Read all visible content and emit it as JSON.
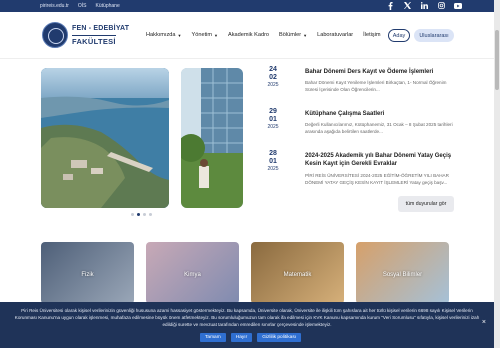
{
  "topbar": {
    "links": [
      "pirireis.edu.tr",
      "OİS",
      "Kütüphane"
    ],
    "social": [
      "facebook-icon",
      "x-icon",
      "linkedin-icon",
      "instagram-icon",
      "youtube-icon"
    ]
  },
  "header": {
    "logo_line1": "FEN - EDEBİYAT",
    "logo_line2": "FAKÜLTESİ",
    "nav": [
      {
        "label": "Hakkımızda",
        "caret": true
      },
      {
        "label": "Yönetim",
        "caret": true
      },
      {
        "label": "Akademik Kadro",
        "caret": false
      },
      {
        "label": "Bölümler",
        "caret": true
      },
      {
        "label": "Laboratuvarlar",
        "caret": false
      },
      {
        "label": "İletişim",
        "caret": false
      }
    ],
    "aday_label": "Aday",
    "intl_label": "Uluslararası"
  },
  "news": [
    {
      "day": "24",
      "month": "02",
      "year": "2025",
      "title": "Bahar Dönemi Ders Kayıt ve Ödeme İşlemleri",
      "desc": "Bahar Dönemi Kayıt Yenileme İşlemleri Birkaçtan, 1- Normal Öğrenim Süresi İçerisinde Olan Öğrencilerin..."
    },
    {
      "day": "29",
      "month": "01",
      "year": "2025",
      "title": "Kütüphane Çalışma Saatleri",
      "desc": "Değerli Kullanıcılarımız, Kütüphanemiz, 31 Ocak – 8 Şubat 2025 tarihleri arasında aşağıda belirtilen saatlerde..."
    },
    {
      "day": "28",
      "month": "01",
      "year": "2025",
      "title": "2024-2025 Akademik yılı Bahar Dönemi Yatay Geçiş Kesin Kayıt için Gerekli Evraklar",
      "desc": "PİRİ REİS ÜNİVERSİTESİ 2024-2025 EĞİTİM-ÖĞRETİM YILI BAHAR DÖNEMİ YATAY GEÇİŞ KESİN KAYIT İŞLEMLERİ Yatay geçiş başv..."
    }
  ],
  "all_news_label": "tüm duyurular gör",
  "cards": [
    {
      "label": "Fizik",
      "color": "#6b7d96"
    },
    {
      "label": "Kimya",
      "color": "#8a8fa6"
    },
    {
      "label": "Matematik",
      "color": "#b08a57"
    },
    {
      "label": "Sosyal Bilimler",
      "color": "#c98a5a"
    }
  ],
  "cookie": {
    "text": "Piri Reis Üniversitesi olarak kişisel verilerinizin güvenliği hususuna azami hassasiyet göstermekteyiz. Bu kapsamda, Üniversite olarak, Üniversite ile ilişkili tüm şahıslara ait her türlü kişisel verilerin 6698 sayılı Kişisel Verilerin Korunması Kanunu'na uygun olarak işlenmesi, muhafaza edilmesine büyük önem atfetmekteyiz. Bu sorumluluğumuzun tam olarak ifa edilmesi için KVK Kanunu kapsamında kurum \"Veri Sorumlusu\" sıfatıyla, kişisel verilerinizi izah edildiği surette ve mevzuat tarafından emredilen sınırlar çerçevesinde işlemekteyiz.",
    "btn_ok": "Tamam",
    "btn_yes": "Hayır",
    "btn_policy": "Gizlilik politikası",
    "close": "×"
  }
}
